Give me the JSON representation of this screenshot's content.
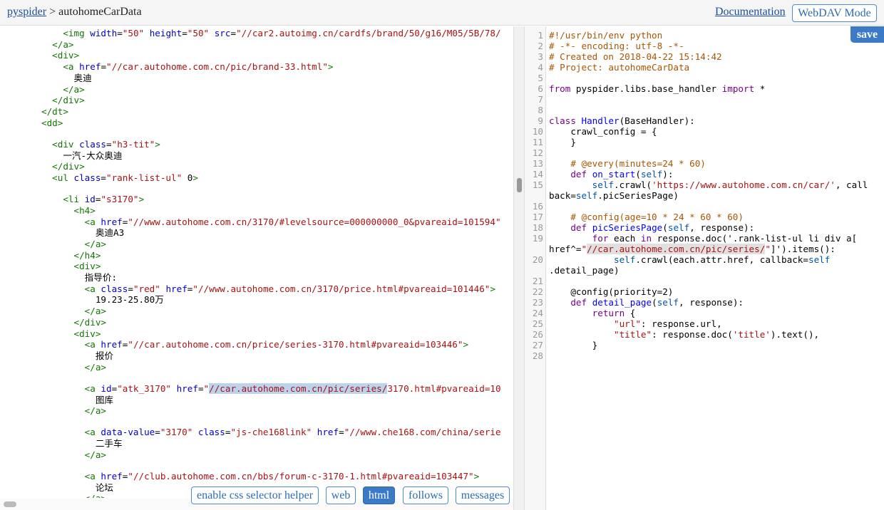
{
  "topbar": {
    "app_name": "pyspider",
    "separator": ">",
    "project_name": "autohomeCarData",
    "doc_link": "Documentation",
    "webdav_button": "WebDAV Mode"
  },
  "editor": {
    "save_button": "save"
  },
  "html_panel": {
    "buttons": [
      "enable css selector helper",
      "web",
      "html",
      "follows",
      "messages"
    ],
    "active_button": "html"
  },
  "html_source_lines": [
    "    <img width=\"50\" height=\"50\" src=\"//car2.autoimg.cn/cardfs/brand/50/g16/M05/5B/78/",
    "  </a>",
    "  <div>",
    "    <a href=\"//car.autohome.com.cn/pic/brand-33.html\">",
    "      奥迪",
    "    </a>",
    "  </div>",
    "</dt>",
    "<dd>",
    "",
    "  <div class=\"h3-tit\">",
    "    一汽-大众奥迪",
    "  </div>",
    "  <ul class=\"rank-list-ul\" 0>",
    "",
    "    <li id=\"s3170\">",
    "      <h4>",
    "        <a href=\"//www.autohome.com.cn/3170/#levelsource=000000000_0&pvareaid=101594\"",
    "          奥迪A3",
    "        </a>",
    "      </h4>",
    "      <div>",
    "        指导价:",
    "        <a class=\"red\" href=\"//www.autohome.com.cn/3170/price.html#pvareaid=101446\">",
    "          19.23-25.80万",
    "        </a>",
    "      </div>",
    "      <div>",
    "        <a href=\"//car.autohome.com.cn/price/series-3170.html#pvareaid=103446\">",
    "          报价",
    "        </a>",
    "",
    "        <a id=\"atk_3170\" href=\"//car.autohome.com.cn/pic/series/3170.html#pvareaid=10",
    "          图库",
    "        </a>",
    "",
    "        <a data-value=\"3170\" class=\"js-che168link\" href=\"//www.che168.com/china/serie",
    "          二手车",
    "        </a>",
    "",
    "        <a href=\"//club.autohome.com.cn/bbs/forum-c-3170-1.html#pvareaid=103447\">",
    "          论坛",
    "        </a>"
  ],
  "code_lines": [
    "#!/usr/bin/env python",
    "# -*- encoding: utf-8 -*-",
    "# Created on 2018-04-22 15:14:42",
    "# Project: autohomeCarData",
    "",
    "from pyspider.libs.base_handler import *",
    "",
    "",
    "class Handler(BaseHandler):",
    "    crawl_config = {",
    "    }",
    "",
    "    # @every(minutes=24 * 60)",
    "    def on_start(self):",
    "        self.crawl('https://www.autohome.com.cn/car/', callback=self.picSeriesPage)",
    "",
    "    # @config(age=10 * 24 * 60 * 60)",
    "    def picSeriesPage(self, response):",
    "        for each in response.doc('.rank-list-ul li div a[href^=\"//car.autohome.com.cn/pic/series/\"]').items():",
    "            self.crawl(each.attr.href, callback=self.detail_page)",
    "",
    "    @config(priority=2)",
    "    def detail_page(self, response):",
    "        return {",
    "            \"url\": response.url,",
    "            \"title\": response.doc('title').text(),",
    "        }",
    ""
  ]
}
